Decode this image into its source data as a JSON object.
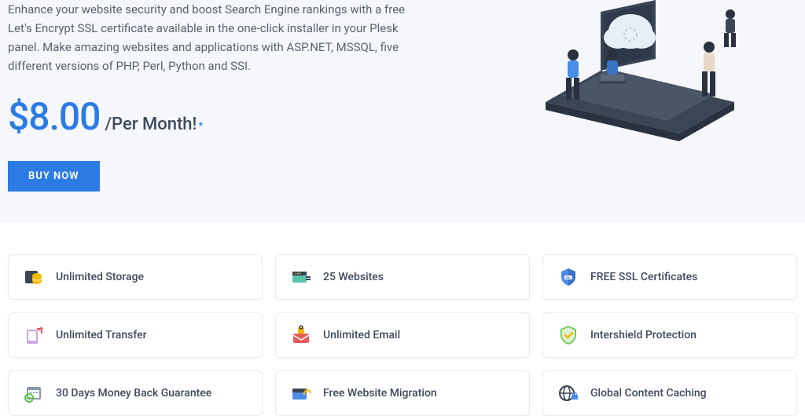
{
  "hero": {
    "description": "Enhance your website security and boost Search Engine rankings with a free Let's Encrypt SSL certificate available in the one-click installer in your Plesk panel. Make amazing websites and applications with ASP.NET, MSSQL, five different versions of PHP, Perl, Python and SSI.",
    "price": "$8.00",
    "price_suffix": "/Per Month!",
    "price_asterisk": "*",
    "buy_label": "BUY NOW"
  },
  "features": [
    {
      "icon": "storage-icon",
      "label": "Unlimited Storage"
    },
    {
      "icon": "websites-icon",
      "label": "25 Websites"
    },
    {
      "icon": "ssl-icon",
      "label": "FREE SSL Certificates"
    },
    {
      "icon": "transfer-icon",
      "label": "Unlimited Transfer"
    },
    {
      "icon": "email-icon",
      "label": "Unlimited Email"
    },
    {
      "icon": "shield-icon",
      "label": "Intershield Protection"
    },
    {
      "icon": "guarantee-icon",
      "label": "30 Days Money Back Guarantee"
    },
    {
      "icon": "migration-icon",
      "label": "Free Website Migration"
    },
    {
      "icon": "caching-icon",
      "label": "Global Content Caching"
    }
  ]
}
